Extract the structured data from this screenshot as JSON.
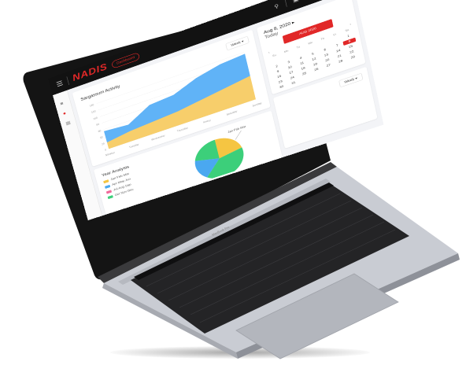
{
  "app": {
    "logo": "NADIS",
    "badge": "Dashboard"
  },
  "topbar_icons": [
    "search-icon",
    "calendar-icon",
    "bell-icon",
    "avatar"
  ],
  "activity_card": {
    "title": "Sargassum Activity",
    "filter": "Week"
  },
  "calendar_card": {
    "date": "Aug 8, 2020",
    "today": "Today",
    "button": "AUG 2020",
    "weekdays": [
      "Su",
      "Mo",
      "Tu",
      "We",
      "Th",
      "Fr",
      "Sa"
    ],
    "days": [
      "",
      "",
      "",
      "",
      "",
      "",
      "1",
      "2",
      "3",
      "4",
      "5",
      "6",
      "7",
      "8",
      "9",
      "10",
      "11",
      "12",
      "13",
      "14",
      "15",
      "16",
      "17",
      "18",
      "19",
      "20",
      "21",
      "22",
      "23",
      "24",
      "25",
      "26",
      "27",
      "28",
      "29",
      "30",
      "31",
      "",
      "",
      "",
      "",
      ""
    ],
    "selected": "8"
  },
  "small_card": {
    "filter": "Week"
  },
  "year_card": {
    "title": "Year Analysis",
    "legend": [
      {
        "label": "Jan Feb Mar",
        "color": "#f5c542"
      },
      {
        "label": "Apr May Jun",
        "color": "#4aa8f0"
      },
      {
        "label": "Jul Aug Sep",
        "color": "#f06a9b"
      },
      {
        "label": "Oct Nov Dec",
        "color": "#3ccf7a"
      }
    ],
    "pie_label": "Jan Feb Mar"
  },
  "laptop": {
    "model": "MacBook Pro"
  },
  "chart_data": {
    "type": "area",
    "title": "Sargassum Activity",
    "categories": [
      "Monday",
      "Tuesday",
      "Wednesday",
      "Thursday",
      "Friday",
      "Saturday",
      "Sunday"
    ],
    "ylim": [
      0,
      140
    ],
    "yticks": [
      0,
      20,
      40,
      60,
      80,
      100,
      120,
      140
    ],
    "series": [
      {
        "name": "",
        "color": "#60b3f7",
        "values": [
          55,
          50,
          85,
          90,
          115,
          130,
          135
        ]
      },
      {
        "name": "",
        "color": "#f7ce6b",
        "values": [
          20,
          30,
          35,
          40,
          50,
          60,
          70
        ]
      }
    ]
  }
}
